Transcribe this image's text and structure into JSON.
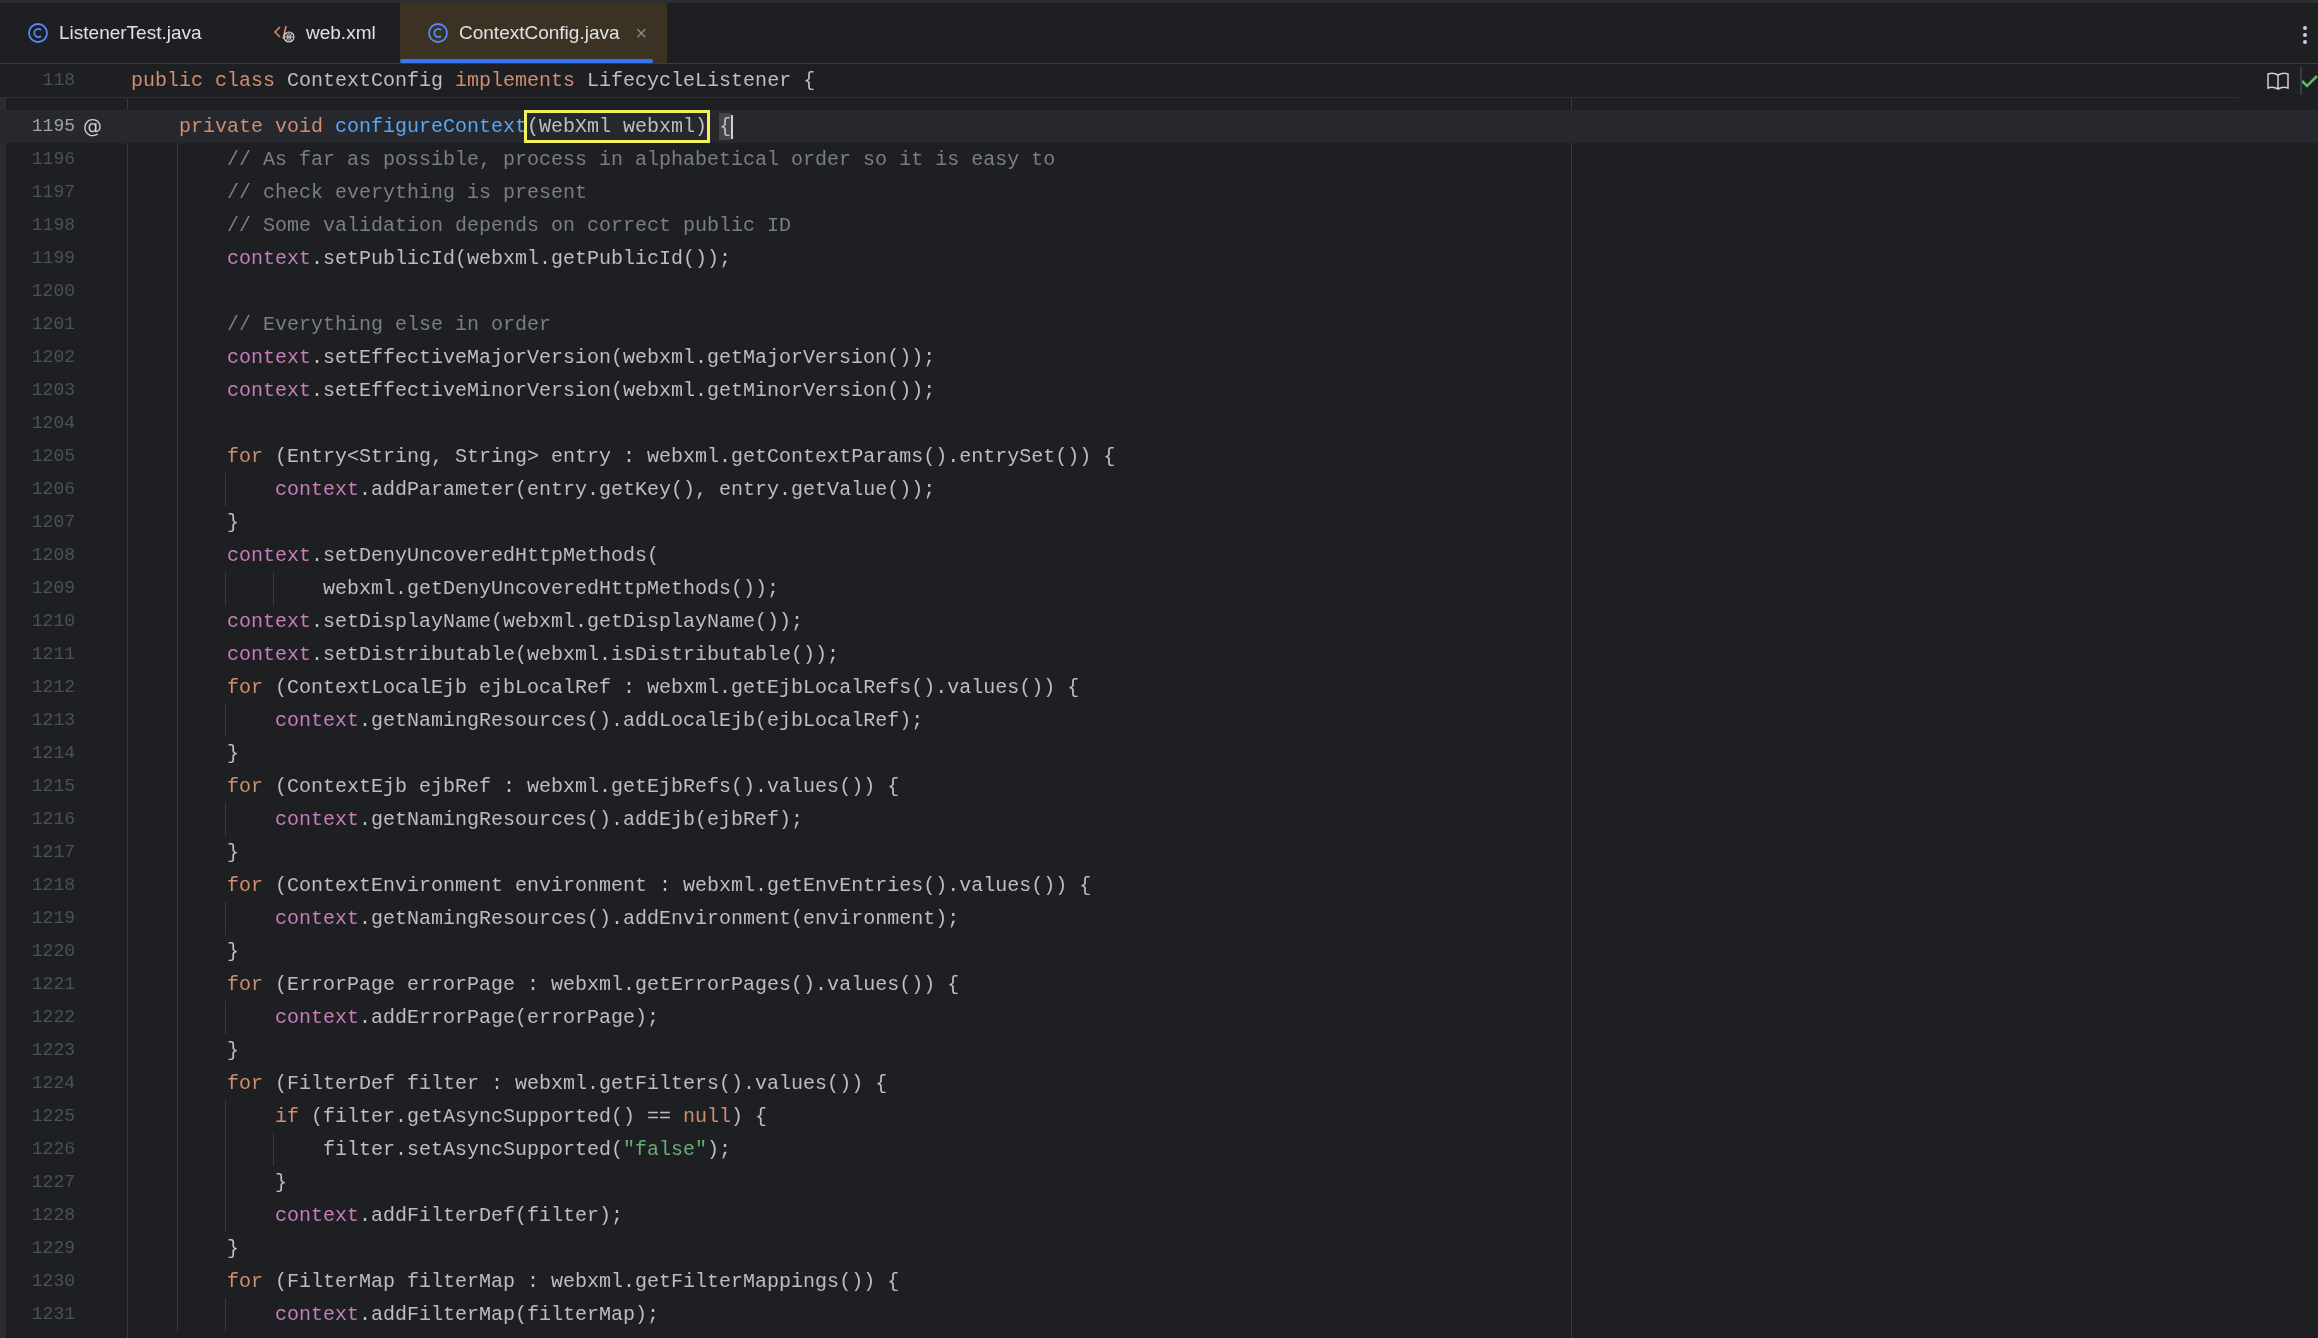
{
  "tabs": [
    {
      "label": "ListenerTest.java",
      "kind": "class",
      "selected": false
    },
    {
      "label": "web.xml",
      "kind": "xml",
      "selected": false
    },
    {
      "label": "ContextConfig.java",
      "kind": "class",
      "selected": true,
      "close_glyph": "×"
    }
  ],
  "sticky_line": {
    "number": "118",
    "tokens": [
      {
        "kind": "keyword",
        "text": "public"
      },
      {
        "kind": "keyword",
        "text": " class"
      },
      {
        "kind": "plain",
        "text": " ContextConfig "
      },
      {
        "kind": "keyword",
        "text": "implements"
      },
      {
        "kind": "plain",
        "text": " LifecycleListener {"
      }
    ]
  },
  "lines": [
    {
      "number": "1195",
      "current": true,
      "gutter_mark": "@",
      "tokens": [
        {
          "kind": "keyword",
          "text": "    private"
        },
        {
          "kind": "keyword",
          "text": " void"
        },
        {
          "kind": "method",
          "text": " configureContext"
        },
        {
          "kind": "match",
          "text": "(WebXml webxml)"
        },
        {
          "kind": "brace",
          "text": " {"
        }
      ]
    },
    {
      "number": "1196",
      "current": false,
      "tokens": [
        {
          "kind": "comment",
          "text": "        // As far as possible, process in alphabetical order so it is easy to"
        }
      ]
    },
    {
      "number": "1197",
      "current": false,
      "tokens": [
        {
          "kind": "comment",
          "text": "        // check everything is present"
        }
      ]
    },
    {
      "number": "1198",
      "current": false,
      "tokens": [
        {
          "kind": "comment",
          "text": "        // Some validation depends on correct public ID"
        }
      ]
    },
    {
      "number": "1199",
      "current": false,
      "tokens": [
        {
          "kind": "field",
          "text": "        context"
        },
        {
          "kind": "plain",
          "text": ".setPublicId(webxml.getPublicId());"
        }
      ]
    },
    {
      "number": "1200",
      "current": false
    },
    {
      "number": "1201",
      "current": false,
      "tokens": [
        {
          "kind": "comment",
          "text": "        // Everything else in order"
        }
      ]
    },
    {
      "number": "1202",
      "current": false,
      "tokens": [
        {
          "kind": "field",
          "text": "        context"
        },
        {
          "kind": "plain",
          "text": ".setEffectiveMajorVersion(webxml.getMajorVersion());"
        }
      ]
    },
    {
      "number": "1203",
      "current": false,
      "tokens": [
        {
          "kind": "field",
          "text": "        context"
        },
        {
          "kind": "plain",
          "text": ".setEffectiveMinorVersion(webxml.getMinorVersion());"
        }
      ]
    },
    {
      "number": "1204",
      "current": false
    },
    {
      "number": "1205",
      "current": false,
      "tokens": [
        {
          "kind": "keyword",
          "text": "        for"
        },
        {
          "kind": "plain",
          "text": " (Entry<String, String> entry : webxml.getContextParams().entrySet()) {"
        }
      ]
    },
    {
      "number": "1206",
      "current": false,
      "tokens": [
        {
          "kind": "field",
          "text": "            context"
        },
        {
          "kind": "plain",
          "text": ".addParameter(entry.getKey(), entry.getValue());"
        }
      ]
    },
    {
      "number": "1207",
      "current": false,
      "tokens": [
        {
          "kind": "plain",
          "text": "        }"
        }
      ]
    },
    {
      "number": "1208",
      "current": false,
      "tokens": [
        {
          "kind": "field",
          "text": "        context"
        },
        {
          "kind": "plain",
          "text": ".setDenyUncoveredHttpMethods("
        }
      ]
    },
    {
      "number": "1209",
      "current": false,
      "tokens": [
        {
          "kind": "plain",
          "text": "                webxml.getDenyUncoveredHttpMethods());"
        }
      ]
    },
    {
      "number": "1210",
      "current": false,
      "tokens": [
        {
          "kind": "field",
          "text": "        context"
        },
        {
          "kind": "plain",
          "text": ".setDisplayName(webxml.getDisplayName());"
        }
      ]
    },
    {
      "number": "1211",
      "current": false,
      "tokens": [
        {
          "kind": "field",
          "text": "        context"
        },
        {
          "kind": "plain",
          "text": ".setDistributable(webxml.isDistributable());"
        }
      ]
    },
    {
      "number": "1212",
      "current": false,
      "tokens": [
        {
          "kind": "keyword",
          "text": "        for"
        },
        {
          "kind": "plain",
          "text": " (ContextLocalEjb ejbLocalRef : webxml.getEjbLocalRefs().values()) {"
        }
      ]
    },
    {
      "number": "1213",
      "current": false,
      "tokens": [
        {
          "kind": "field",
          "text": "            context"
        },
        {
          "kind": "plain",
          "text": ".getNamingResources().addLocalEjb(ejbLocalRef);"
        }
      ]
    },
    {
      "number": "1214",
      "current": false,
      "tokens": [
        {
          "kind": "plain",
          "text": "        }"
        }
      ]
    },
    {
      "number": "1215",
      "current": false,
      "tokens": [
        {
          "kind": "keyword",
          "text": "        for"
        },
        {
          "kind": "plain",
          "text": " (ContextEjb ejbRef : webxml.getEjbRefs().values()) {"
        }
      ]
    },
    {
      "number": "1216",
      "current": false,
      "tokens": [
        {
          "kind": "field",
          "text": "            context"
        },
        {
          "kind": "plain",
          "text": ".getNamingResources().addEjb(ejbRef);"
        }
      ]
    },
    {
      "number": "1217",
      "current": false,
      "tokens": [
        {
          "kind": "plain",
          "text": "        }"
        }
      ]
    },
    {
      "number": "1218",
      "current": false,
      "tokens": [
        {
          "kind": "keyword",
          "text": "        for"
        },
        {
          "kind": "plain",
          "text": " (ContextEnvironment environment : webxml.getEnvEntries().values()) {"
        }
      ]
    },
    {
      "number": "1219",
      "current": false,
      "tokens": [
        {
          "kind": "field",
          "text": "            context"
        },
        {
          "kind": "plain",
          "text": ".getNamingResources().addEnvironment(environment);"
        }
      ]
    },
    {
      "number": "1220",
      "current": false,
      "tokens": [
        {
          "kind": "plain",
          "text": "        }"
        }
      ]
    },
    {
      "number": "1221",
      "current": false,
      "tokens": [
        {
          "kind": "keyword",
          "text": "        for"
        },
        {
          "kind": "plain",
          "text": " (ErrorPage errorPage : webxml.getErrorPages().values()) {"
        }
      ]
    },
    {
      "number": "1222",
      "current": false,
      "tokens": [
        {
          "kind": "field",
          "text": "            context"
        },
        {
          "kind": "plain",
          "text": ".addErrorPage(errorPage);"
        }
      ]
    },
    {
      "number": "1223",
      "current": false,
      "tokens": [
        {
          "kind": "plain",
          "text": "        }"
        }
      ]
    },
    {
      "number": "1224",
      "current": false,
      "tokens": [
        {
          "kind": "keyword",
          "text": "        for"
        },
        {
          "kind": "plain",
          "text": " (FilterDef filter : webxml.getFilters().values()) {"
        }
      ]
    },
    {
      "number": "1225",
      "current": false,
      "tokens": [
        {
          "kind": "keyword",
          "text": "            if"
        },
        {
          "kind": "plain",
          "text": " (filter.getAsyncSupported() == "
        },
        {
          "kind": "keyword",
          "text": "null"
        },
        {
          "kind": "plain",
          "text": ") {"
        }
      ]
    },
    {
      "number": "1226",
      "current": false,
      "tokens": [
        {
          "kind": "plain",
          "text": "                filter.setAsyncSupported("
        },
        {
          "kind": "string",
          "text": "\"false\""
        },
        {
          "kind": "plain",
          "text": ");"
        }
      ]
    },
    {
      "number": "1227",
      "current": false,
      "tokens": [
        {
          "kind": "plain",
          "text": "            }"
        }
      ]
    },
    {
      "number": "1228",
      "current": false,
      "tokens": [
        {
          "kind": "field",
          "text": "            context"
        },
        {
          "kind": "plain",
          "text": ".addFilterDef(filter);"
        }
      ]
    },
    {
      "number": "1229",
      "current": false,
      "tokens": [
        {
          "kind": "plain",
          "text": "        }"
        }
      ]
    },
    {
      "number": "1230",
      "current": false,
      "tokens": [
        {
          "kind": "keyword",
          "text": "        for"
        },
        {
          "kind": "plain",
          "text": " (FilterMap filterMap : webxml.getFilterMappings()) {"
        }
      ]
    },
    {
      "number": "1231",
      "current": false,
      "tokens": [
        {
          "kind": "field",
          "text": "            context"
        },
        {
          "kind": "plain",
          "text": ".addFilterMap(filterMap);"
        }
      ]
    }
  ]
}
